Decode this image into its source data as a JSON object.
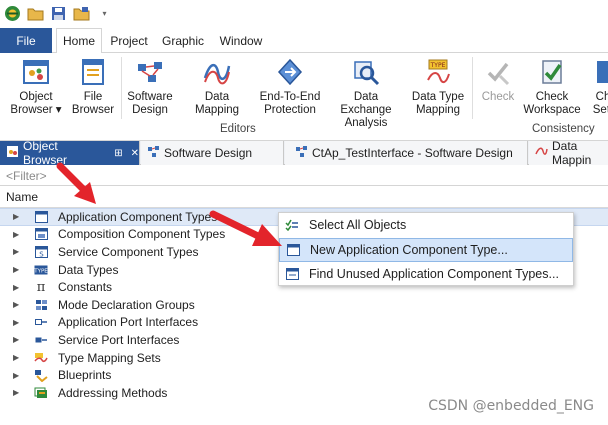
{
  "menu": {
    "file": "File",
    "tabs": [
      "Home",
      "Project",
      "Graphic",
      "Window"
    ]
  },
  "ribbon": {
    "buttons": [
      {
        "line1": "Object",
        "line2": "Browser ▾",
        "icon": "object-browser-icon"
      },
      {
        "line1": "File",
        "line2": "Browser",
        "icon": "file-browser-icon"
      },
      {
        "line1": "Software",
        "line2": "Design",
        "icon": "software-design-icon"
      },
      {
        "line1": "Data Mapping",
        "line2": "",
        "icon": "data-mapping-icon"
      },
      {
        "line1": "End-To-End",
        "line2": "Protection",
        "icon": "end-to-end-protection-icon"
      },
      {
        "line1": "Data Exchange",
        "line2": "Analysis",
        "icon": "data-exchange-icon"
      },
      {
        "line1": "Data Type",
        "line2": "Mapping",
        "icon": "data-type-mapping-icon"
      },
      {
        "line1": "Check",
        "line2": "",
        "icon": "check-icon"
      },
      {
        "line1": "Check",
        "line2": "Workspace",
        "icon": "check-workspace-icon"
      },
      {
        "line1": "Ch",
        "line2": "Sett",
        "icon": "check-settings-icon"
      }
    ],
    "groups": {
      "editors": "Editors",
      "consistency": "Consistency"
    }
  },
  "doc_tabs": [
    {
      "label": "Object Browser",
      "pin": "⊞",
      "close": "✕"
    },
    {
      "label": "Software Design"
    },
    {
      "label": "CtAp_TestInterface - Software Design"
    },
    {
      "label": "Data Mappin"
    }
  ],
  "filter": {
    "placeholder": "<Filter>"
  },
  "tree": {
    "header": "Name",
    "items": [
      {
        "label": "Application Component Types",
        "icon": "application-component-icon"
      },
      {
        "label": "Composition Component Types",
        "icon": "composition-component-icon"
      },
      {
        "label": "Service Component Types",
        "icon": "service-component-icon"
      },
      {
        "label": "Data Types",
        "icon": "data-types-icon"
      },
      {
        "label": "Constants",
        "icon": "pi-icon"
      },
      {
        "label": "Mode Declaration Groups",
        "icon": "mode-declaration-icon"
      },
      {
        "label": "Application Port Interfaces",
        "icon": "application-port-icon"
      },
      {
        "label": "Service Port Interfaces",
        "icon": "service-port-icon"
      },
      {
        "label": "Type Mapping Sets",
        "icon": "type-mapping-icon"
      },
      {
        "label": "Blueprints",
        "icon": "blueprints-icon"
      },
      {
        "label": "Addressing Methods",
        "icon": "addressing-icon"
      }
    ]
  },
  "context_menu": {
    "items": [
      {
        "label": "Select All Objects",
        "icon": "select-all-icon"
      },
      {
        "label": "New Application Component Type...",
        "icon": "new-component-icon"
      },
      {
        "label": "Find Unused Application Component Types...",
        "icon": "find-unused-icon"
      }
    ]
  },
  "watermark": "CSDN @enbedded_ENG",
  "colors": {
    "accent": "#2a579a",
    "selection": "#dfe9f7",
    "arrow": "#e3242b"
  }
}
